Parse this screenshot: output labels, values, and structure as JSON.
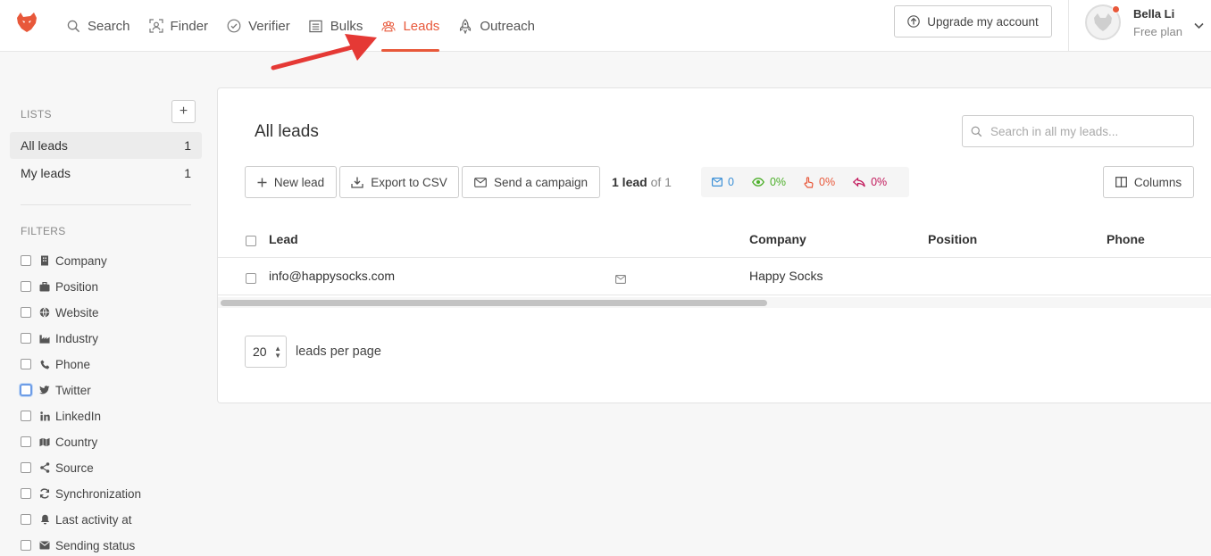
{
  "nav": {
    "items": [
      {
        "label": "Search",
        "icon": "search-icon"
      },
      {
        "label": "Finder",
        "icon": "finder-icon"
      },
      {
        "label": "Verifier",
        "icon": "check-circle-icon"
      },
      {
        "label": "Bulks",
        "icon": "list-icon"
      },
      {
        "label": "Leads",
        "icon": "leads-icon",
        "active": true
      },
      {
        "label": "Outreach",
        "icon": "rocket-icon"
      }
    ],
    "accent_color": "#e8583a"
  },
  "header": {
    "upgrade_label": "Upgrade my account",
    "user_name": "Bella Li",
    "user_plan": "Free plan"
  },
  "sidebar": {
    "lists_title": "LISTS",
    "lists": [
      {
        "label": "All leads",
        "count": "1",
        "active": true
      },
      {
        "label": "My leads",
        "count": "1"
      }
    ],
    "filters_title": "FILTERS",
    "filters": [
      {
        "label": "Company",
        "icon": "building-icon"
      },
      {
        "label": "Position",
        "icon": "briefcase-icon"
      },
      {
        "label": "Website",
        "icon": "globe-icon"
      },
      {
        "label": "Industry",
        "icon": "industry-icon"
      },
      {
        "label": "Phone",
        "icon": "phone-icon"
      },
      {
        "label": "Twitter",
        "icon": "twitter-icon",
        "focused": true
      },
      {
        "label": "LinkedIn",
        "icon": "linkedin-icon"
      },
      {
        "label": "Country",
        "icon": "map-icon"
      },
      {
        "label": "Source",
        "icon": "share-icon"
      },
      {
        "label": "Synchronization",
        "icon": "sync-icon"
      },
      {
        "label": "Last activity at",
        "icon": "bell-icon"
      },
      {
        "label": "Sending status",
        "icon": "envelope-icon"
      }
    ]
  },
  "main": {
    "title": "All leads",
    "search_placeholder": "Search in all my leads...",
    "buttons": {
      "new_lead": "New lead",
      "export": "Export to CSV",
      "campaign": "Send a campaign",
      "columns": "Columns"
    },
    "count": {
      "main": "1 lead",
      "of": "of 1"
    },
    "stats": [
      {
        "value": "0",
        "icon": "envelope-icon",
        "color": "#3a8fd6"
      },
      {
        "value": "0%",
        "icon": "eye-icon",
        "color": "#4caf2a"
      },
      {
        "value": "0%",
        "icon": "click-icon",
        "color": "#e8583a"
      },
      {
        "value": "0%",
        "icon": "reply-icon",
        "color": "#c2185b"
      }
    ],
    "table": {
      "columns": [
        "Lead",
        "Company",
        "Position",
        "Phone"
      ],
      "rows": [
        {
          "lead": "info@happysocks.com",
          "company": "Happy Socks",
          "position": "",
          "phone": ""
        }
      ]
    },
    "per_page": {
      "value": "20",
      "label": "leads per page"
    }
  }
}
